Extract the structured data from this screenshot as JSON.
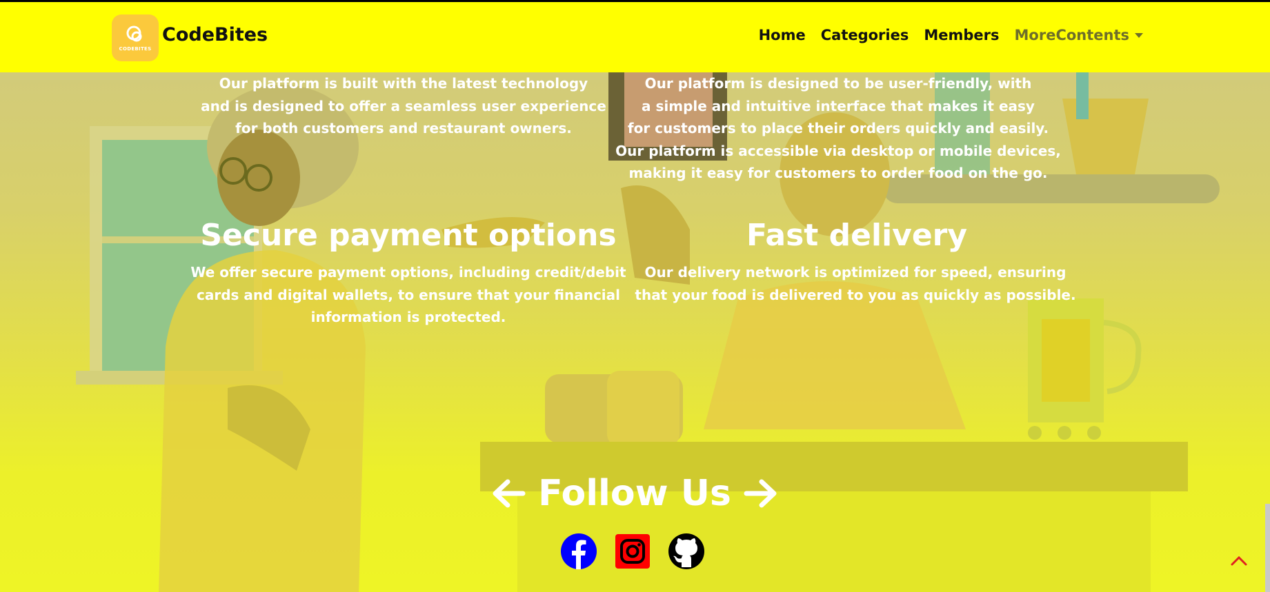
{
  "navbar": {
    "brand": "CodeBites",
    "logo_text": "CODEBITES",
    "links": {
      "home": "Home",
      "categories": "Categories",
      "members": "Members",
      "more": "MoreContents"
    },
    "background": "#ffff00"
  },
  "features": {
    "technology": {
      "lines": [
        "Our platform is built with the latest technology",
        "and is designed to offer a seamless user experience",
        "for both customers and restaurant owners."
      ]
    },
    "user_friendly": {
      "lines": [
        "Our platform is designed to be user-friendly, with",
        "a simple and intuitive interface that makes it easy",
        "for customers to place their orders quickly and easily.",
        "Our platform is accessible via desktop or mobile devices,",
        "making it easy for customers to order food on the go."
      ]
    },
    "secure_payment": {
      "title": "Secure payment options",
      "lines": [
        "We offer secure payment options, including credit/debit",
        "cards and digital wallets, to ensure that your financial",
        "information is protected."
      ]
    },
    "fast_delivery": {
      "title": "Fast delivery",
      "lines": [
        "Our delivery network is optimized for speed, ensuring",
        "that your food is delivered to you as quickly as possible."
      ]
    }
  },
  "follow": {
    "title": "Follow Us",
    "socials": [
      {
        "name": "facebook-icon",
        "color": "#0000ff"
      },
      {
        "name": "instagram-icon",
        "color": "#ff0000"
      },
      {
        "name": "github-icon",
        "color": "#000000"
      }
    ]
  },
  "scroll_top": {
    "icon": "chevron-up-icon",
    "color": "#e02020"
  }
}
